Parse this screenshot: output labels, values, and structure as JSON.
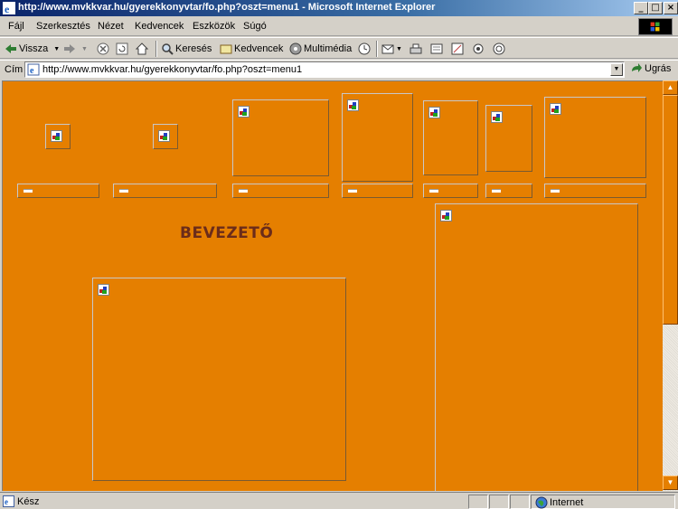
{
  "window": {
    "title": "http://www.mvkkvar.hu/gyerekkonyvtar/fo.php?oszt=menu1 - Microsoft Internet Explorer",
    "controls": {
      "minimize": "_",
      "maximize": "□",
      "close": "×"
    }
  },
  "menu": [
    "Fájl",
    "Szerkesztés",
    "Nézet",
    "Kedvencek",
    "Eszközök",
    "Súgó"
  ],
  "toolbar": {
    "back": "Vissza",
    "search": "Keresés",
    "favorites": "Kedvencek",
    "media": "Multimédia"
  },
  "address": {
    "label": "Cím",
    "url": "http://www.mvkkvar.hu/gyerekkonyvtar/fo.php?oszt=menu1",
    "go": "Ugrás"
  },
  "page": {
    "heading": "BEVEZETŐ",
    "background": "#e57f00"
  },
  "status": {
    "text": "Kész",
    "zone": "Internet"
  },
  "icons": {
    "broken_image": "broken-image-icon",
    "ie": "ie-icon",
    "globe": "internet-zone-icon"
  }
}
